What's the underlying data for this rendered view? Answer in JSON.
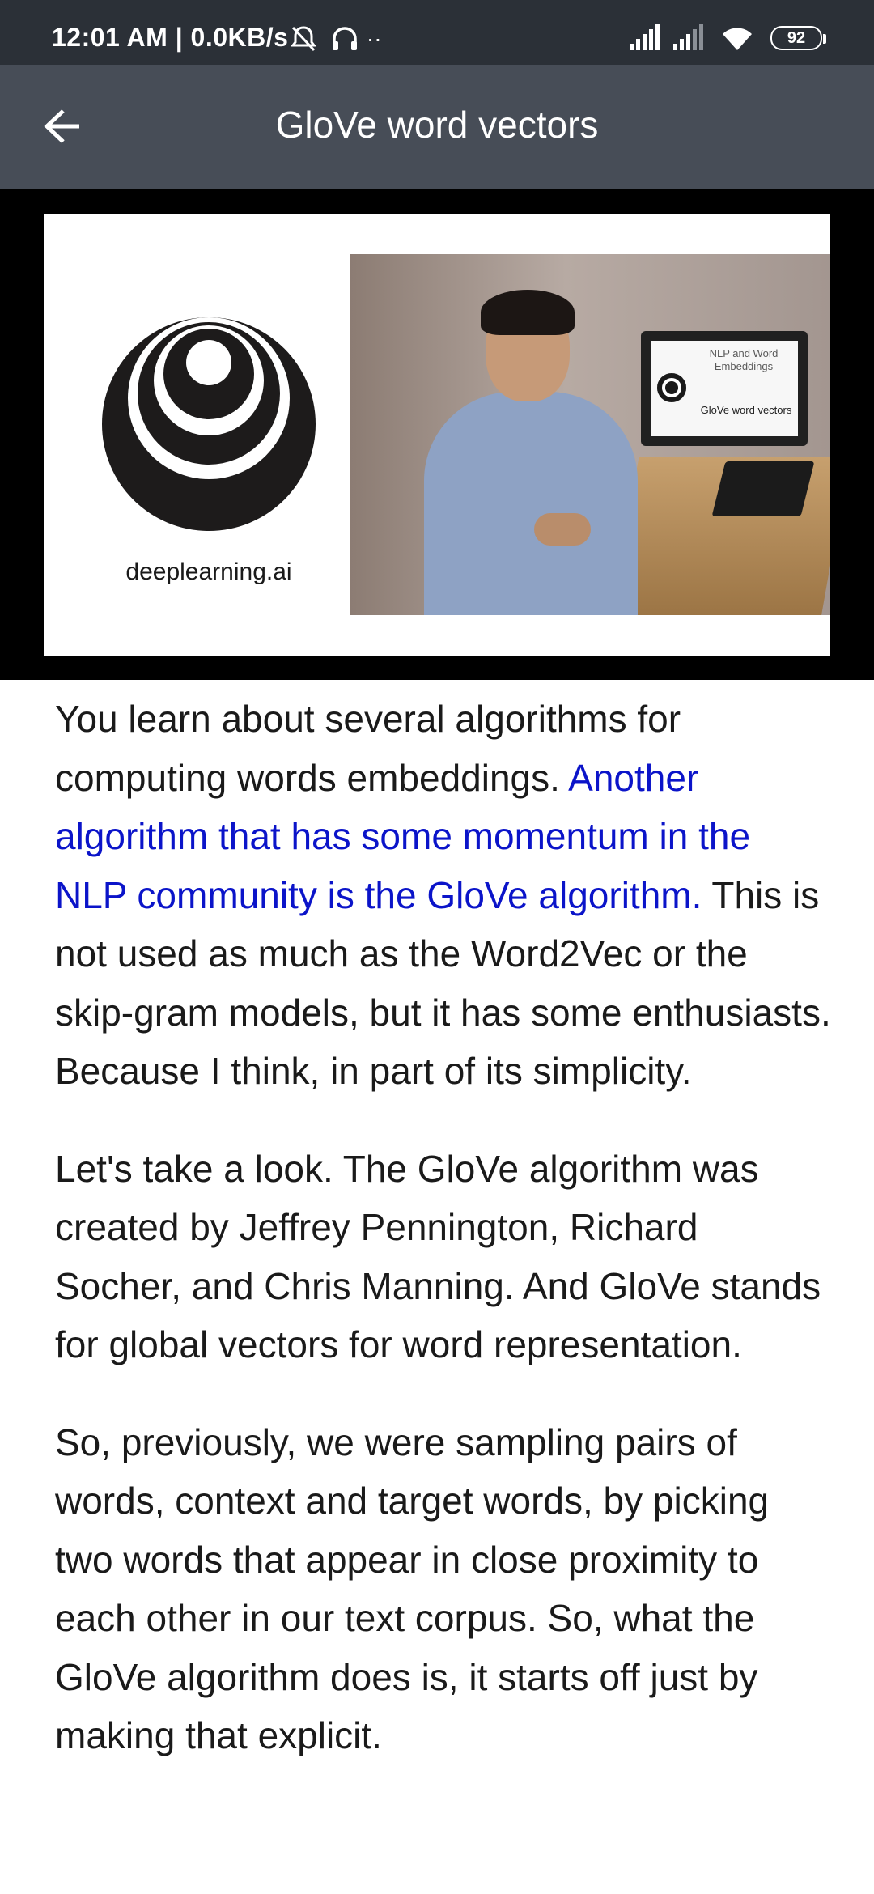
{
  "status_bar": {
    "time_and_speed": "12:01 AM | 0.0KB/s",
    "battery": "92"
  },
  "app_bar": {
    "title": "GloVe word vectors"
  },
  "video": {
    "brand": "deeplearning.ai",
    "slide_title": "NLP and Word Embeddings",
    "slide_subtitle": "GloVe word vectors"
  },
  "transcript": {
    "p1_before": "You learn about several algorithms for computing words embeddings. ",
    "p1_highlight": "Another algorithm that has some momentum in the NLP community is the GloVe algorithm.",
    "p1_after": " This is not used as much as the Word2Vec or the skip-gram models, but it has some enthusiasts. Because I think, in part of its simplicity.",
    "p2": "Let's take a look. The GloVe algorithm was created by Jeffrey Pennington, Richard Socher, and Chris Manning. And GloVe stands for global vectors for word representation.",
    "p3": "So, previously, we were sampling pairs of words, context and target words, by picking two words that appear in close proximity to each other in our text corpus. So, what the GloVe algorithm does is, it starts off just by making that explicit."
  },
  "colors": {
    "status_bar": "#2b3037",
    "app_bar": "#474d57",
    "highlight_text": "#0b14c9"
  },
  "icons": [
    "back-arrow-icon",
    "mute-icon",
    "headphones-icon",
    "signal-icon",
    "wifi-icon",
    "battery-icon"
  ]
}
